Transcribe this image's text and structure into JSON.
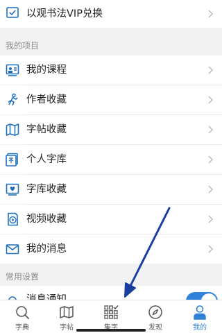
{
  "colors": {
    "accent": "#2f80d8",
    "icon": "#1d6fbf",
    "section_bg": "#f2f2f2",
    "annotation_arrow": "#1a3fa0"
  },
  "top_item": {
    "label": "以观书法VIP兑换",
    "icon": "gift-box-icon"
  },
  "section_projects": {
    "title": "我的项目",
    "items": [
      {
        "label": "我的课程",
        "icon": "course-board-icon"
      },
      {
        "label": "作者收藏",
        "icon": "running-person-icon"
      },
      {
        "label": "字帖收藏",
        "icon": "map-book-icon"
      },
      {
        "label": "个人字库",
        "icon": "character-library-icon"
      },
      {
        "label": "字库收藏",
        "icon": "heart-tray-icon"
      },
      {
        "label": "视频收藏",
        "icon": "video-play-icon"
      },
      {
        "label": "我的消息",
        "icon": "envelope-icon"
      }
    ]
  },
  "section_settings": {
    "title": "常用设置",
    "items": [
      {
        "label": "消息通知",
        "icon": "bell-icon",
        "toggle_on": true
      }
    ]
  },
  "tabbar": {
    "tabs": [
      {
        "label": "字典",
        "icon": "search-icon",
        "active": false
      },
      {
        "label": "字帖",
        "icon": "map-icon",
        "active": false
      },
      {
        "label": "集字",
        "icon": "grid-check-icon",
        "active": false
      },
      {
        "label": "发现",
        "icon": "compass-icon",
        "active": false
      },
      {
        "label": "我的",
        "icon": "person-icon",
        "active": true
      }
    ]
  }
}
